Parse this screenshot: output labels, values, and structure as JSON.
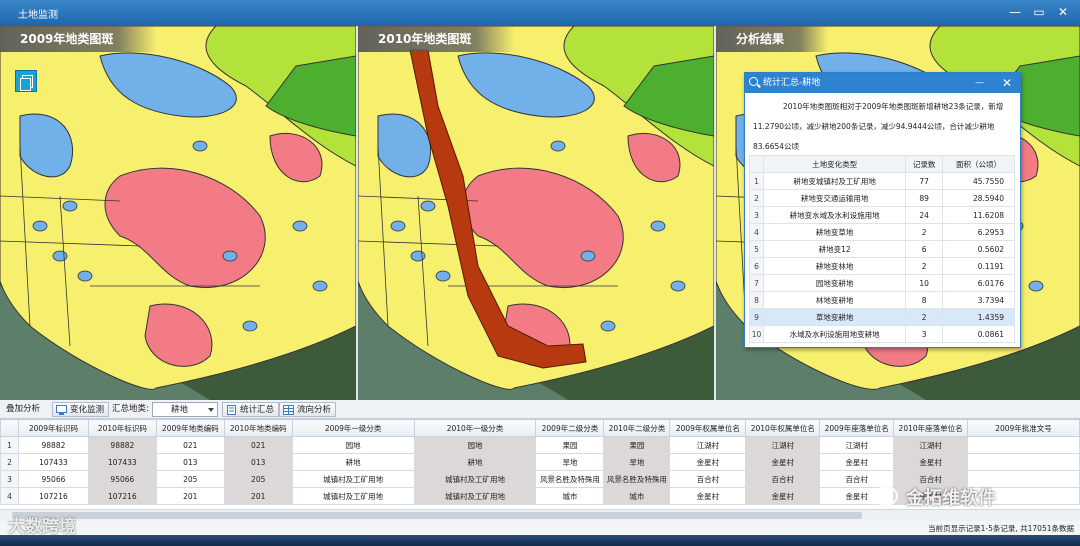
{
  "window": {
    "title": "土地监测",
    "btn_min": "—",
    "btn_restore": "▭",
    "btn_close": "✕"
  },
  "panels": {
    "p2009": "2009年地类图斑",
    "p2010": "2010年地类图斑",
    "result": "分析结果"
  },
  "stats": {
    "title": "统计汇总-耕地",
    "summary": "2010年地类图斑相对于2009年地类图斑新增耕地23条记录，新增11.2790公顷，减少耕地200条记录，减少94.9444公顷，合计减少耕地83.6654公顷",
    "headers": [
      "土地变化类型",
      "记录数",
      "面积（公顷）"
    ],
    "rows": [
      [
        "1",
        "耕地变城镇村及工矿用地",
        "77",
        "45.7550"
      ],
      [
        "2",
        "耕地变交通运输用地",
        "89",
        "28.5940"
      ],
      [
        "3",
        "耕地变水域及水利设施用地",
        "24",
        "11.6208"
      ],
      [
        "4",
        "耕地变草地",
        "2",
        "6.2953"
      ],
      [
        "5",
        "耕地变12",
        "6",
        "0.5602"
      ],
      [
        "6",
        "耕地变林地",
        "2",
        "0.1191"
      ],
      [
        "7",
        "园地变耕地",
        "10",
        "6.0176"
      ],
      [
        "8",
        "林地变耕地",
        "8",
        "3.7394"
      ],
      [
        "9",
        "草地变耕地",
        "2",
        "1.4359"
      ],
      [
        "10",
        "水域及水利设施用地变耕地",
        "3",
        "0.0861"
      ]
    ]
  },
  "toolbar": {
    "overlay_label": "叠加分析",
    "change_btn": "变化监测",
    "summary_type_label": "汇总地类:",
    "summary_type_value": "耕地",
    "stats_btn": "统计汇总",
    "flow_btn": "流向分析"
  },
  "grid": {
    "headers": [
      "2009年标识码",
      "2010年标识码",
      "2009年地类编码",
      "2010年地类编码",
      "2009年一级分类",
      "2010年一级分类",
      "2009年二级分类",
      "2010年二级分类",
      "2009年权属单位名",
      "2010年权属单位名",
      "2009年座落单位名",
      "2010年座落单位名",
      "2009年批准文号"
    ],
    "rows": [
      [
        "1",
        "98882",
        "98882",
        "021",
        "021",
        "园地",
        "园地",
        "果园",
        "果园",
        "江湖村",
        "江湖村",
        "江湖村",
        "江湖村",
        ""
      ],
      [
        "2",
        "107433",
        "107433",
        "013",
        "013",
        "耕地",
        "耕地",
        "旱地",
        "旱地",
        "金星村",
        "金星村",
        "金星村",
        "金星村",
        ""
      ],
      [
        "3",
        "95066",
        "95066",
        "205",
        "205",
        "城镇村及工矿用地",
        "城镇村及工矿用地",
        "风景名胜及特殊用",
        "风景名胜及特殊用",
        "百合村",
        "百合村",
        "百合村",
        "百合村",
        ""
      ],
      [
        "4",
        "107216",
        "107216",
        "201",
        "201",
        "城镇村及工矿用地",
        "城镇村及工矿用地",
        "城市",
        "城市",
        "金星村",
        "金星村",
        "金星村",
        "金星村",
        ""
      ]
    ]
  },
  "status": {
    "text": "当前页显示记录1-5条记录, 共17051条数据"
  },
  "watermarks": {
    "left": "大数跨境",
    "right": "金拓维软件"
  },
  "colors": {
    "title_blue": "#2d83d2",
    "farmland_yellow": "#f7f06e",
    "construction_pink": "#f27b86",
    "water_blue": "#72b0ea",
    "forest_green": "#4caf2f",
    "change_brown": "#b6390f"
  }
}
